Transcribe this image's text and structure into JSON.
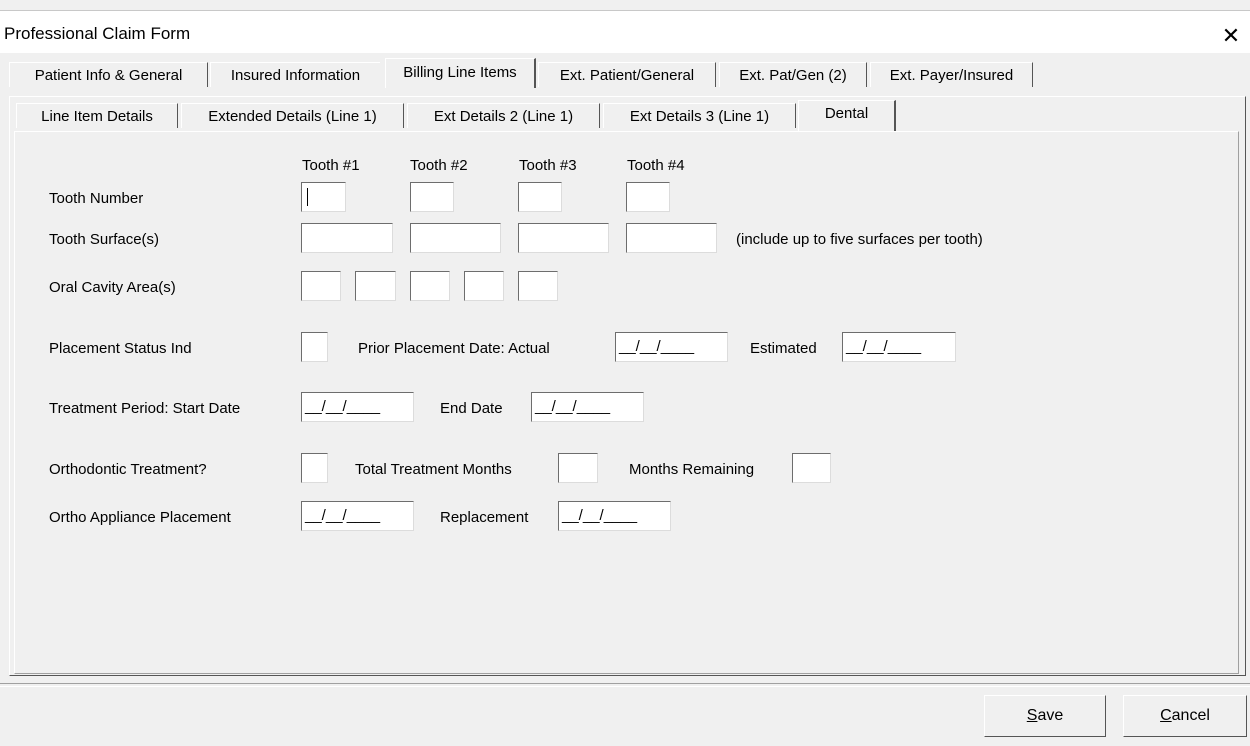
{
  "window": {
    "title": "Professional Claim Form",
    "close_glyph": "✕"
  },
  "main_tabs": [
    {
      "label": "Patient Info & General"
    },
    {
      "label": "Insured Information"
    },
    {
      "label": "Billing Line Items",
      "active": true
    },
    {
      "label": "Ext. Patient/General"
    },
    {
      "label": "Ext. Pat/Gen (2)"
    },
    {
      "label": "Ext. Payer/Insured"
    }
  ],
  "sub_tabs": [
    {
      "label": "Line Item Details"
    },
    {
      "label": "Extended Details (Line 1)"
    },
    {
      "label": "Ext Details 2 (Line 1)"
    },
    {
      "label": "Ext Details 3 (Line 1)"
    },
    {
      "label": "Dental",
      "active": true
    }
  ],
  "dental": {
    "tooth_headers": [
      "Tooth #1",
      "Tooth #2",
      "Tooth #3",
      "Tooth #4"
    ],
    "tooth_number_label": "Tooth Number",
    "tooth_numbers": [
      "",
      "",
      "",
      ""
    ],
    "tooth_surface_label": "Tooth Surface(s)",
    "tooth_surfaces": [
      "",
      "",
      "",
      ""
    ],
    "surface_hint": "(include up to five surfaces per tooth)",
    "oral_cavity_label": "Oral Cavity Area(s)",
    "oral_cavity": [
      "",
      "",
      "",
      "",
      ""
    ],
    "placement_status_label": "Placement Status Ind",
    "placement_status": "",
    "prior_placement_label": "Prior Placement Date:  Actual",
    "prior_actual": "__/__/____",
    "estimated_label": "Estimated",
    "prior_estimated": "__/__/____",
    "treatment_period_label": "Treatment Period:  Start Date",
    "start_date": "__/__/____",
    "end_date_label": "End Date",
    "end_date": "__/__/____",
    "ortho_treatment_label": "Orthodontic Treatment?",
    "ortho_treatment": "",
    "total_months_label": "Total Treatment Months",
    "total_months": "",
    "months_remaining_label": "Months Remaining",
    "months_remaining": "",
    "appliance_placement_label": "Ortho Appliance Placement",
    "appliance_placement": "__/__/____",
    "replacement_label": "Replacement",
    "replacement": "__/__/____"
  },
  "footer": {
    "save_label": "Save",
    "save_mnemonic": "S",
    "save_rest": "ave",
    "cancel_label": "Cancel",
    "cancel_mnemonic": "C",
    "cancel_rest": "ancel"
  }
}
